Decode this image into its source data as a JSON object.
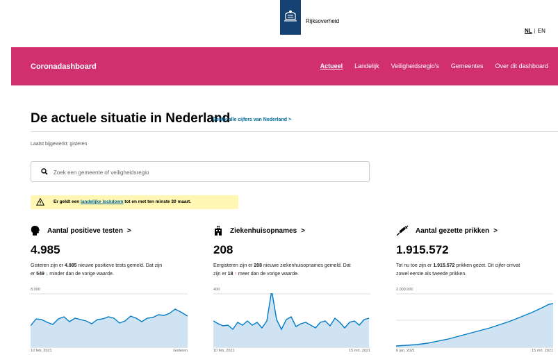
{
  "header": {
    "org_name": "Rijksoverheid",
    "lang_nl": "NL",
    "lang_sep": "|",
    "lang_en": "EN"
  },
  "nav": {
    "brand": "Coronadashboard",
    "items": [
      "Actueel",
      "Landelijk",
      "Veiligheidsregio's",
      "Gemeentes",
      "Over dit dashboard"
    ]
  },
  "main": {
    "title": "De actuele situatie in Nederland",
    "title_link": "Bekijk alle cijfers van Nederland >",
    "updated": "Laatst bijgewerkt: gisteren"
  },
  "search": {
    "placeholder": "Zoek een gemeente of veiligheidsregio"
  },
  "alert": {
    "pre": "Er geldt een ",
    "link": "landelijke lockdown",
    "post": " tot en met ten minste 30 maart."
  },
  "cards": [
    {
      "title": "Aantal positieve testen",
      "chevron": ">",
      "value": "4.985",
      "desc_1": "Gisteren zijn er ",
      "desc_num": "4.985",
      "desc_2": " nieuwe positieve tests gemeld. Dat zijn",
      "desc_3": "er ",
      "desc_delta": "549",
      "desc_arrow": "↓",
      "desc_4": " minder dan de vorige waarde.",
      "ymax": "8.000",
      "x_start": "10 feb. 2021",
      "x_end": "Gisteren",
      "icon": "person-head-icon"
    },
    {
      "title": "Ziekenhuisopnames",
      "chevron": ">",
      "value": "208",
      "desc_1": "Eergisteren zijn er ",
      "desc_num": "208",
      "desc_2": " nieuwe ziekenhuisopnames gemeld. Dat",
      "desc_3": "zijn er ",
      "desc_delta": "18",
      "desc_arrow": "↑",
      "desc_4": " meer dan de vorige waarde.",
      "ymax": "400",
      "x_start": "10 feb. 2021",
      "x_end": "15 mrt. 2021",
      "icon": "hospital-icon"
    },
    {
      "title": "Aantal gezette prikken",
      "chevron": ">",
      "value": "1.915.572",
      "desc_1": "Tot nu toe zijn er ",
      "desc_num": "1.915.572",
      "desc_2": " prikken gezet. Dit cijfer omvat",
      "desc_3": "zowel eerste als tweede prikken.",
      "desc_delta": "",
      "desc_arrow": "",
      "desc_4": "",
      "ymax": "2.000.000",
      "x_start": "6 jan. 2021",
      "x_end": "15 mrt. 2021",
      "icon": "syringe-icon"
    }
  ],
  "colors": {
    "brand_pink": "#d12f6e",
    "chart_line": "#007bc7",
    "chart_fill": "#cfe3f3",
    "alert_bg": "#fff7b3",
    "logo_blue": "#154273"
  }
}
